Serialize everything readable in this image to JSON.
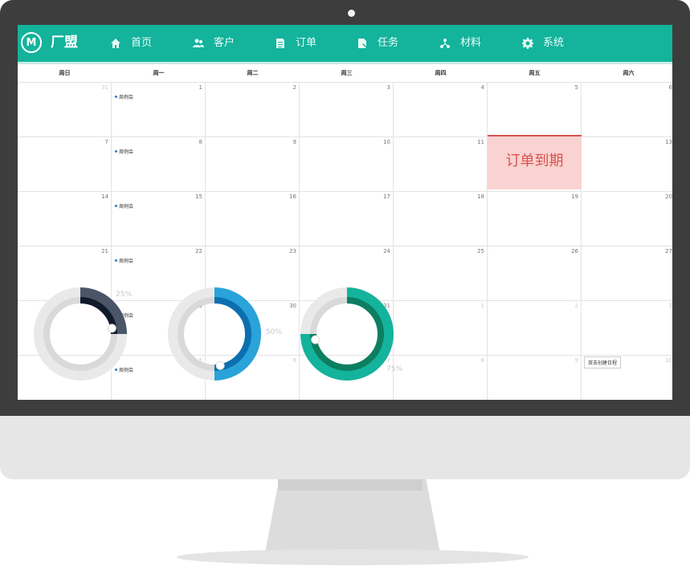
{
  "app": {
    "logo_letter": "M",
    "logo_text": "厂盟"
  },
  "nav": [
    {
      "label": "首页",
      "icon": "home-icon"
    },
    {
      "label": "客户",
      "icon": "users-icon"
    },
    {
      "label": "订单",
      "icon": "document-icon"
    },
    {
      "label": "任务",
      "icon": "task-icon"
    },
    {
      "label": "材料",
      "icon": "material-icon"
    },
    {
      "label": "系统",
      "icon": "gear-icon"
    }
  ],
  "calendar": {
    "weekdays": [
      "周日",
      "周一",
      "周二",
      "周三",
      "周四",
      "周五",
      "周六"
    ],
    "weeks": [
      [
        "31",
        "1",
        "2",
        "3",
        "4",
        "5",
        "6"
      ],
      [
        "7",
        "8",
        "9",
        "10",
        "11",
        "12",
        "13"
      ],
      [
        "14",
        "15",
        "16",
        "17",
        "18",
        "19",
        "20"
      ],
      [
        "21",
        "22",
        "23",
        "24",
        "25",
        "26",
        "27"
      ],
      [
        "28",
        "29",
        "30",
        "31",
        "1",
        "2",
        "3"
      ],
      [
        "4",
        "5",
        "6",
        "7",
        "8",
        "9",
        "10"
      ]
    ],
    "muted": [
      [
        0,
        0
      ],
      [
        4,
        4
      ],
      [
        4,
        5
      ],
      [
        4,
        6
      ],
      [
        5,
        0
      ],
      [
        5,
        1
      ],
      [
        5,
        2
      ],
      [
        5,
        3
      ],
      [
        5,
        4
      ],
      [
        5,
        5
      ],
      [
        5,
        6
      ]
    ],
    "event_label": "周例会",
    "event_cells": [
      [
        0,
        1
      ],
      [
        1,
        1
      ],
      [
        2,
        1
      ],
      [
        3,
        1
      ],
      [
        4,
        1
      ],
      [
        5,
        1
      ]
    ],
    "highlight": {
      "label": "订单到期",
      "week": 2,
      "day": 5
    },
    "tooltip": "双击创建日程"
  },
  "gauges": [
    {
      "label": "25%",
      "value": 0.25,
      "color_outer": "#4a5568",
      "color_inner": "#0f1a2b"
    },
    {
      "label": "50%",
      "value": 0.5,
      "color_outer": "#29a3d9",
      "color_inner": "#0b6fb0"
    },
    {
      "label": "75%",
      "value": 0.75,
      "color_outer": "#14b39c",
      "color_inner": "#0d7e60"
    }
  ],
  "colors": {
    "navbar": "#13b39c",
    "highlight_bg": "#f9d3d1",
    "highlight_text": "#d9534f",
    "event_dot": "#2d7fd1"
  }
}
